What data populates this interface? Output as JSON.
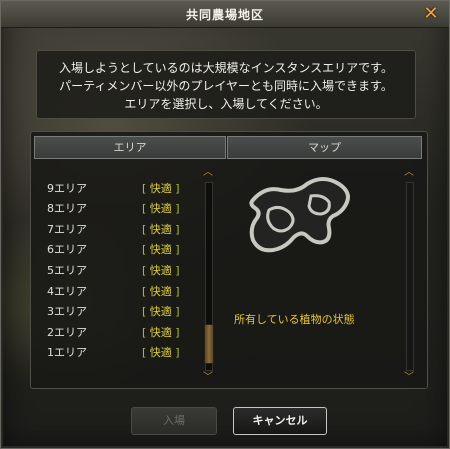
{
  "window": {
    "title": "共同農場地区",
    "close_symbol": "✕"
  },
  "message": {
    "lines": [
      "入場しようとしているのは大規模なインスタンスエリアです。",
      "パーティメンバー以外のプレイヤーとも同時に入場できます。",
      "エリアを選択し、入場してください。"
    ]
  },
  "columns": {
    "area": "エリア",
    "map": "マップ"
  },
  "areas": [
    {
      "name": "9エリア",
      "status_open": "[",
      "status": "快適",
      "status_close": "]"
    },
    {
      "name": "8エリア",
      "status_open": "[",
      "status": "快適",
      "status_close": "]"
    },
    {
      "name": "7エリア",
      "status_open": "[",
      "status": "快適",
      "status_close": "]"
    },
    {
      "name": "6エリア",
      "status_open": "[",
      "status": "快適",
      "status_close": "]"
    },
    {
      "name": "5エリア",
      "status_open": "[",
      "status": "快適",
      "status_close": "]"
    },
    {
      "name": "4エリア",
      "status_open": "[",
      "status": "快適",
      "status_close": "]"
    },
    {
      "name": "3エリア",
      "status_open": "[",
      "status": "快適",
      "status_close": "]"
    },
    {
      "name": "2エリア",
      "status_open": "[",
      "status": "快適",
      "status_close": "]"
    },
    {
      "name": "1エリア",
      "status_open": "[",
      "status": "快適",
      "status_close": "]"
    }
  ],
  "map": {
    "caption": "所有している植物の状態",
    "icon": "farm-map-outline"
  },
  "scroll": {
    "up_icon": "chevron-up-icon",
    "down_icon": "chevron-down-icon",
    "up_symbol": "︿",
    "down_symbol": "﹀"
  },
  "buttons": {
    "enter": "入場",
    "cancel": "キャンセル"
  },
  "colors": {
    "status_green": "#a9c13a",
    "caption_yellow": "#e8c53a",
    "close_orange": "#f3a23a"
  }
}
